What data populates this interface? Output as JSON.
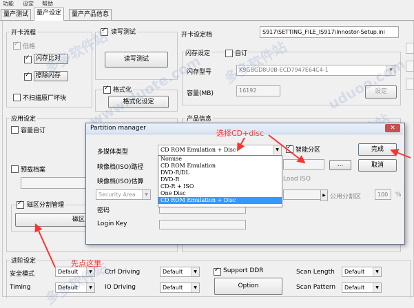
{
  "menu": [
    "功能",
    "设定",
    "帮助"
  ],
  "tabs": [
    "量产测试",
    "量产设定",
    "量产产品信息"
  ],
  "boot_flow": {
    "title": "开卡流程",
    "low_format": "低格",
    "flash_compare": "闪存比对",
    "erase_flash": "擦除闪存",
    "skip_factory_bad": "不扫描原厂坏块"
  },
  "rw_test": {
    "title": "读写测试",
    "button": "读写测试"
  },
  "format": {
    "title": "格式化",
    "button": "格式化设定"
  },
  "setting_file": {
    "label": "开卡设定档",
    "value": "S917\\SETTING_FILE_IS917\\Innostor-Setup.ini"
  },
  "flash_setting": {
    "title": "闪存设定",
    "custom": "自订",
    "model_label": "闪存型号",
    "model_value": "K9GBGD8U0B-ECD7947E64C4-1",
    "capacity_label": "容量(MB)",
    "capacity_value": "16192",
    "set_button": "设定"
  },
  "app_setting": {
    "title": "应用设定",
    "capacity_custom": "容量自订",
    "preset_file": "预载档案",
    "partition_mgmt": "磁区分割管理",
    "partition_button": "磁区"
  },
  "product_info": {
    "title": "产品信息"
  },
  "advanced": {
    "title": "进阶设定",
    "safe_mode": "安全模式",
    "timing": "Timing",
    "ctrl_driving": "Ctrl Driving",
    "io_driving": "IO Driving",
    "default": "Default",
    "support_ddr": "Support DDR",
    "option": "Option",
    "scan_length": "Scan Length",
    "scan_pattern": "Scan Pattern"
  },
  "dialog": {
    "title": "Partition manager",
    "close": "✕",
    "media_type_label": "多媒体类型",
    "media_type_value": "CD ROM Emulation + Disc",
    "iso_path_label": "映像档(ISO)路径",
    "iso_estimate_label": "映像档(ISO)估算",
    "load_iso": "Load ISO",
    "security_area": "Security Area",
    "password_label": "密码",
    "login_key_label": "Login Key",
    "smart_partition": "智能分区",
    "done_button": "完成",
    "cancel_button": "取消",
    "browse_button": "...",
    "public_partition": "公用分割区",
    "public_value": "100",
    "percent": "%",
    "options": [
      "Nonuse",
      "CD ROM Emulation",
      "DVD-R/DL",
      "DVD-R",
      "CD-R + ISO",
      "One Disc",
      "CD ROM Emulation + Disc"
    ]
  },
  "annotations": {
    "select_cd": "选择CD+disc",
    "click_here": "先点这里"
  },
  "watermarks": [
    "多多软件站",
    "www.duote.com",
    "多多软件站",
    "多多软件站",
    "uduoo.com",
    "多多软件站"
  ],
  "colors": {
    "annotation": "#ff3030",
    "selection": "#3399ff",
    "close": "#c75050"
  }
}
